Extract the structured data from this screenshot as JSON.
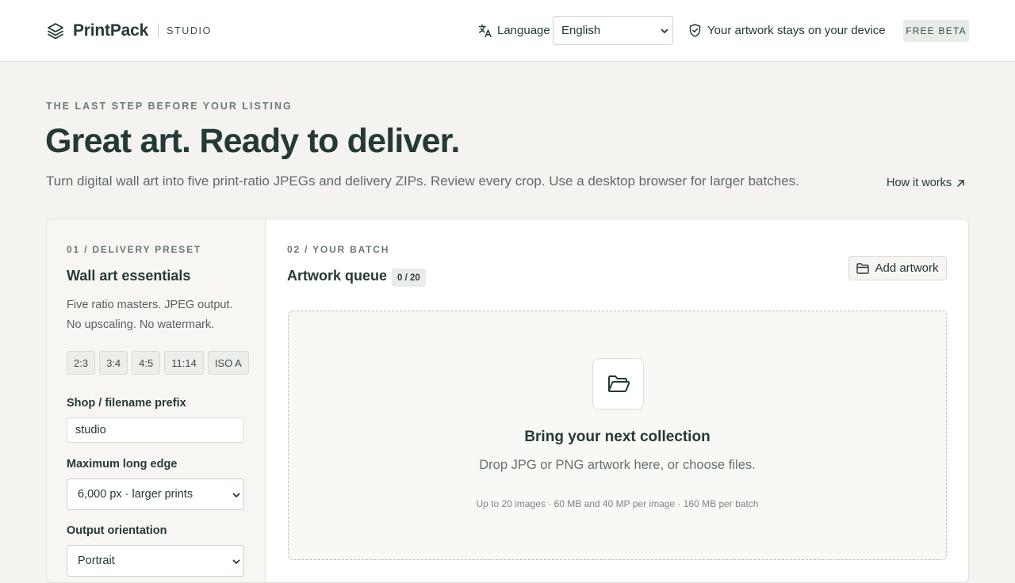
{
  "header": {
    "brand_name": "PrintPack",
    "brand_tag": "STUDIO",
    "language_label": "Language",
    "language_selected": "English",
    "language_options": [
      "English"
    ],
    "privacy_note": "Your artwork stays on your device",
    "beta_badge": "FREE BETA",
    "icons": [
      "layers-logo-icon",
      "translate-icon",
      "shield-check-icon",
      "chevron-down-icon"
    ]
  },
  "hero": {
    "eyebrow": "THE LAST STEP BEFORE YOUR LISTING",
    "title": "Great art. Ready to deliver.",
    "subtitle": "Turn digital wall art into five print-ratio JPEGs and delivery ZIPs. Review every crop. Use a desktop browser for larger batches.",
    "how_it_works": "How it works"
  },
  "preset": {
    "section_label": "01 / DELIVERY PRESET",
    "title": "Wall art essentials",
    "description": "Five ratio masters. JPEG output. No upscaling. No watermark.",
    "ratios": [
      "2:3",
      "3:4",
      "4:5",
      "11:14",
      "ISO A"
    ],
    "prefix_label": "Shop / filename prefix",
    "prefix_value": "studio",
    "long_edge_label": "Maximum long edge",
    "long_edge_value": "6,000 px · larger prints",
    "orientation_label": "Output orientation",
    "orientation_value": "Portrait"
  },
  "batch": {
    "section_label": "02 / YOUR BATCH",
    "queue_title": "Artwork queue",
    "queue_count": "0 / 20",
    "add_button": "Add artwork",
    "drop_title": "Bring your next collection",
    "drop_subtitle": "Drop JPG or PNG artwork here, or choose files.",
    "drop_limits": "Up to 20 images · 60 MB and 40 MP per image · 160 MB per batch"
  },
  "colors": {
    "ink": "#243a37",
    "background": "#f4f3f0",
    "badge": "#e8ece6"
  }
}
